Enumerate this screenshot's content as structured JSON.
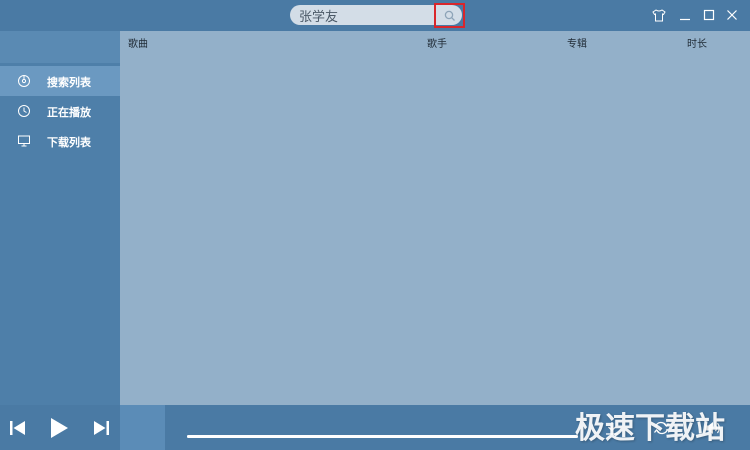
{
  "search": {
    "value": "张学友",
    "placeholder": ""
  },
  "sidebar": {
    "items": [
      {
        "label": "搜索列表",
        "icon": "disc-icon",
        "active": true
      },
      {
        "label": "正在播放",
        "icon": "clock-icon",
        "active": false
      },
      {
        "label": "下载列表",
        "icon": "monitor-icon",
        "active": false
      }
    ]
  },
  "table": {
    "columns": [
      "歌曲",
      "歌手",
      "专辑",
      "时长"
    ]
  },
  "player": {
    "progress": 1.0
  },
  "watermark": "极速下载站",
  "colors": {
    "titlebar": "#4a7aa4",
    "sidebar": "#4e7fa9",
    "sidebar_active": "#6b99c1",
    "main": "#93b0c9",
    "highlight_border": "#d9262b"
  }
}
